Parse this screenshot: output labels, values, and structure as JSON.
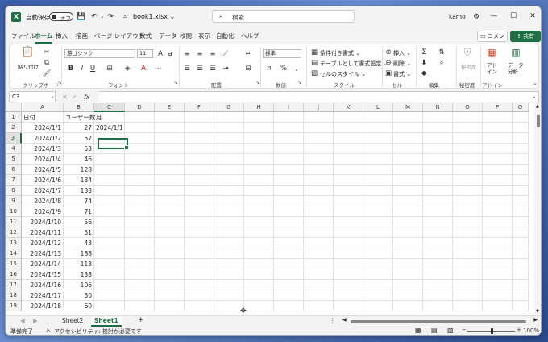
{
  "titlebar": {
    "app_letter": "X",
    "autosave_label": "自動保存",
    "autosave_state": "オフ",
    "filename": "book1.xlsx ⌄",
    "search_placeholder": "検索",
    "user": "kamo",
    "minimize": "—",
    "maximize": "☐",
    "close": "✕"
  },
  "tabs": [
    "ファイル",
    "ホーム",
    "挿入",
    "描画",
    "ページ レイアウト",
    "数式",
    "データ",
    "校閲",
    "表示",
    "自動化",
    "ヘルプ"
  ],
  "active_tab": "ホーム",
  "ribbon": {
    "paste_label": "貼り付け",
    "clipboard_group": "クリップボード",
    "font_name": "游ゴシック",
    "font_size": "11",
    "font_group": "フォント",
    "align_group": "配置",
    "number_format": "標準",
    "number_group": "数値",
    "cond_format": "条件付き書式 ⌄",
    "table_format": "テーブルとして書式設定 ⌄",
    "cell_style": "セルのスタイル ⌄",
    "style_group": "スタイル",
    "insert": "挿入 ⌄",
    "delete": "削除 ⌄",
    "format": "書式 ⌄",
    "cells_group": "セル",
    "edit_group": "編集",
    "sensitivity": "秘密度",
    "sensitivity_group": "秘密度",
    "addin": "アド\nイン",
    "addin_group": "アドイン",
    "analyze": "データ\n分析",
    "comment_btn": "コメント",
    "share_btn": "共有"
  },
  "formula_bar": {
    "namebox": "C3",
    "fx": "fx",
    "formula": ""
  },
  "grid": {
    "columns": [
      "A",
      "B",
      "C",
      "D",
      "E",
      "F",
      "G",
      "H",
      "I",
      "J",
      "K",
      "L",
      "M",
      "N",
      "O",
      "P",
      "Q"
    ],
    "selected_column": "C",
    "selected_row": 3,
    "rows": [
      {
        "n": "1",
        "a": "日付",
        "b": "ユーザー数",
        "c": "月"
      },
      {
        "n": "2",
        "a": "2024/1/1",
        "b": "27",
        "c": "2024/1/1"
      },
      {
        "n": "3",
        "a": "2024/1/2",
        "b": "57",
        "c": ""
      },
      {
        "n": "4",
        "a": "2024/1/3",
        "b": "53",
        "c": ""
      },
      {
        "n": "5",
        "a": "2024/1/4",
        "b": "46",
        "c": ""
      },
      {
        "n": "6",
        "a": "2024/1/5",
        "b": "128",
        "c": ""
      },
      {
        "n": "7",
        "a": "2024/1/6",
        "b": "134",
        "c": ""
      },
      {
        "n": "8",
        "a": "2024/1/7",
        "b": "133",
        "c": ""
      },
      {
        "n": "9",
        "a": "2024/1/8",
        "b": "74",
        "c": ""
      },
      {
        "n": "10",
        "a": "2024/1/9",
        "b": "71",
        "c": ""
      },
      {
        "n": "11",
        "a": "2024/1/10",
        "b": "56",
        "c": ""
      },
      {
        "n": "12",
        "a": "2024/1/11",
        "b": "51",
        "c": ""
      },
      {
        "n": "13",
        "a": "2024/1/12",
        "b": "43",
        "c": ""
      },
      {
        "n": "14",
        "a": "2024/1/13",
        "b": "188",
        "c": ""
      },
      {
        "n": "15",
        "a": "2024/1/14",
        "b": "113",
        "c": ""
      },
      {
        "n": "16",
        "a": "2024/1/15",
        "b": "138",
        "c": ""
      },
      {
        "n": "17",
        "a": "2024/1/16",
        "b": "106",
        "c": ""
      },
      {
        "n": "18",
        "a": "2024/1/17",
        "b": "50",
        "c": ""
      },
      {
        "n": "19",
        "a": "2024/1/18",
        "b": "60",
        "c": ""
      }
    ]
  },
  "sheets": [
    "Sheet2",
    "Sheet1"
  ],
  "active_sheet": "Sheet1",
  "add_sheet": "+",
  "status": {
    "ready": "準備完了",
    "accessibility": "アクセシビリティ: 検討が必要です",
    "zoom": "100%"
  }
}
